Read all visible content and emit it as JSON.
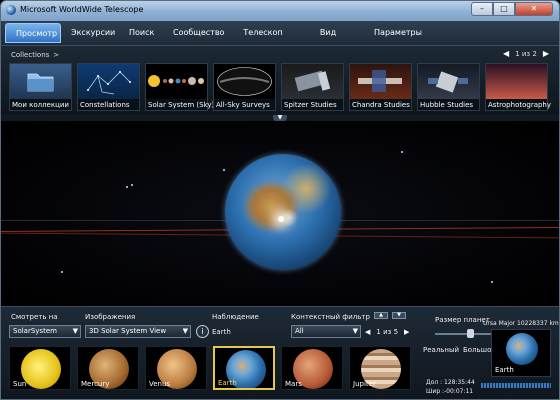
{
  "window": {
    "title": "Microsoft WorldWide Telescope",
    "minimize": "–",
    "maximize": "□",
    "close": "✕"
  },
  "tabs": [
    {
      "label": "Просмотр",
      "active": true
    },
    {
      "label": "Экскурсии"
    },
    {
      "label": "Поиск"
    },
    {
      "label": "Сообщество"
    },
    {
      "label": "Телескоп"
    },
    {
      "label": "Вид"
    },
    {
      "label": "Параметры"
    }
  ],
  "collections": {
    "label": "Collections",
    "chevron": ">",
    "pager": {
      "prev": "◀",
      "text": "1 из 2",
      "next": "▶"
    },
    "items": [
      {
        "label": "Мои коллекции",
        "icon": "folder-icon"
      },
      {
        "label": "Constellations"
      },
      {
        "label": "Solar System (Sky)"
      },
      {
        "label": "All-Sky Surveys"
      },
      {
        "label": "Spitzer Studies"
      },
      {
        "label": "Chandra Studies"
      },
      {
        "label": "Hubble Studies"
      },
      {
        "label": "Astrophotography"
      }
    ],
    "expander": "▼"
  },
  "bottom": {
    "look_at": {
      "label": "Смотреть на",
      "value": "SolarSystem"
    },
    "imagery": {
      "label": "Изображения",
      "value": "3D Solar System View"
    },
    "info": "i",
    "observation": {
      "label": "Наблюдение",
      "value": "Earth"
    },
    "context_filter": {
      "label": "Контекстный фильтр",
      "value": "All"
    },
    "spin_up": "▲",
    "spin_down": "▼",
    "pager": {
      "prev": "◀",
      "text": "1 из 5",
      "next": "▶"
    },
    "planets": [
      {
        "label": "Sun"
      },
      {
        "label": "Mercury"
      },
      {
        "label": "Venus"
      },
      {
        "label": "Earth",
        "selected": true
      },
      {
        "label": "Mars"
      },
      {
        "label": "Jupiter"
      }
    ],
    "planet_size": {
      "label": "Размер планет",
      "min_label": "Реальный",
      "max_label": "Большой"
    },
    "constellation": "Ursa Major",
    "distance": "10228337 km",
    "preview_label": "Earth",
    "coords": {
      "dec_label": "Дол :",
      "dec_value": "128:35:44",
      "lat_label": "Шир :",
      "lat_value": "-00:07:11"
    }
  }
}
